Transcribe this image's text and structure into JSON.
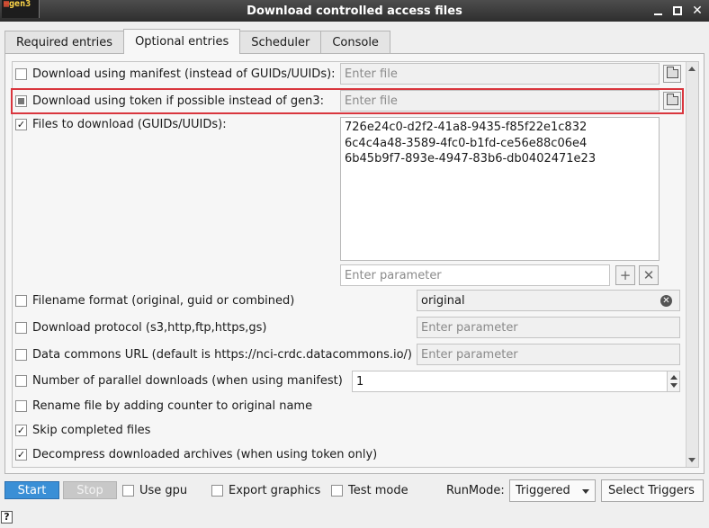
{
  "window": {
    "title": "Download controlled access files",
    "app_icon_text": "gen3"
  },
  "tabs": [
    {
      "label": "Required entries"
    },
    {
      "label": "Optional entries"
    },
    {
      "label": "Scheduler"
    },
    {
      "label": "Console"
    }
  ],
  "options": {
    "manifest": {
      "label": "Download using manifest (instead of GUIDs/UUIDs):",
      "placeholder": "Enter file",
      "checked": false
    },
    "token": {
      "label": "Download using token if possible instead of gen3:",
      "placeholder": "Enter file",
      "checked": "partial"
    },
    "files": {
      "label": "Files to download (GUIDs/UUIDs):",
      "checked": true,
      "items": [
        "726e24c0-d2f2-41a8-9435-f85f22e1c832",
        "6c4c4a48-3589-4fc0-b1fd-ce56e88c06e4",
        "6b45b9f7-893e-4947-83b6-db0402471e23"
      ],
      "param_placeholder": "Enter parameter"
    },
    "filename_format": {
      "label": "Filename format (original, guid or combined)",
      "value": "original",
      "checked": false
    },
    "protocol": {
      "label": "Download protocol (s3,http,ftp,https,gs)",
      "placeholder": "Enter parameter",
      "checked": false
    },
    "commons_url": {
      "label": "Data commons URL (default is https://nci-crdc.datacommons.io/)",
      "placeholder": "Enter parameter",
      "checked": false
    },
    "parallel": {
      "label": "Number of parallel downloads (when using manifest)",
      "value": "1",
      "checked": false
    },
    "rename": {
      "label": "Rename file by adding counter to original name",
      "checked": false
    },
    "skip": {
      "label": "Skip completed files",
      "checked": true
    },
    "decompress": {
      "label": "Decompress downloaded archives (when using token only)",
      "checked": true
    }
  },
  "toolbar": {
    "start": "Start",
    "stop": "Stop",
    "use_gpu": "Use gpu",
    "export_graphics": "Export graphics",
    "test_mode": "Test mode",
    "runmode_label": "RunMode:",
    "runmode_value": "Triggered",
    "select_triggers": "Select Triggers",
    "help": "?"
  },
  "colors": {
    "accent": "#3a8fd6",
    "highlight": "#d9363e",
    "titlebar": "#2e2e2e"
  },
  "checkmark": "✓"
}
